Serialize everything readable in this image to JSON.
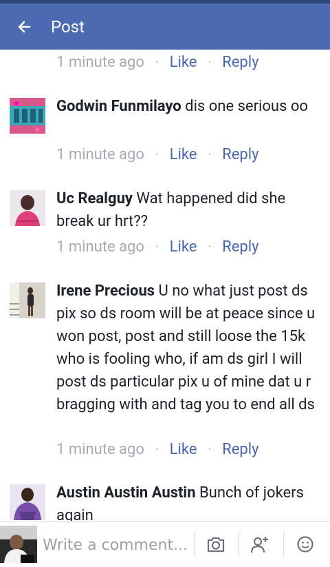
{
  "header": {
    "title": "Post"
  },
  "meta_labels": {
    "like": "Like",
    "reply": "Reply",
    "dot": "·"
  },
  "top_meta": {
    "time": "1 minute ago"
  },
  "comments": [
    {
      "name": "Godwin Funmilayo",
      "text": " dis one serious oo",
      "time": "1 minute ago"
    },
    {
      "name": "Uc Realguy",
      "text": " Wat happened did she break ur hrt??",
      "time": "1 minute ago"
    },
    {
      "name": "Irene Precious",
      "text": " U no what just post ds pix so ds room will be at peace since u won post, post and still loose the 15k who is fooling who, if am ds girl I will post ds particular pix u of mine dat u r bragging with and tag you to end all ds",
      "time": "1 minute ago"
    },
    {
      "name": "Austin Austin Austin",
      "text": " Bunch of jokers again"
    }
  ],
  "composer": {
    "placeholder": "Write a comment..."
  },
  "icons": {
    "back": "arrow-left-icon",
    "camera": "camera-icon",
    "tag_friend": "add-friend-icon",
    "sticker": "smiley-icon"
  },
  "colors": {
    "header_bg": "#4c6ab1",
    "status_bar": "#2f4778",
    "link": "#4b66b0",
    "meta_text": "#a7aab0",
    "body_text": "#1d2129"
  }
}
